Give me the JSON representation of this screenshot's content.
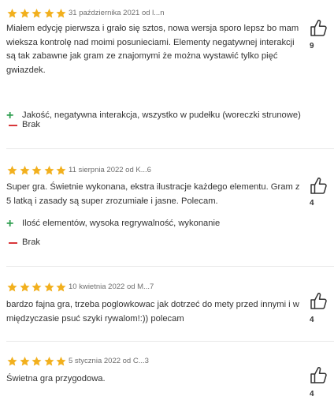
{
  "colors": {
    "star": "#f2b01e",
    "pro": "#2e9e4f",
    "con": "#d8373a",
    "divider": "#e8e8e8"
  },
  "icons": {
    "rating": "star-icon",
    "pros": "plus-icon",
    "cons": "minus-icon",
    "vote": "thumbs-up-icon"
  },
  "reviews": [
    {
      "rating": 5,
      "meta": "31 października 2021 od l...n",
      "text": "Miałem edycję pierwsza i grało się sztos, nowa wersja sporo lepsz bo mam wieksza kontrolę nad moimi posunieciami. Elementy negatywnej interakcji są tak zabawne jak gram ze znajomymi że można wystawić tylko pięć gwiazdek.",
      "pros": "Jakość, negatywna interakcja, wszystko w pudełku (woreczki strunowe)",
      "cons": "Brak",
      "votes": "9"
    },
    {
      "rating": 5,
      "meta": "11 sierpnia 2022 od K...6",
      "text": "Super gra. Świetnie wykonana, ekstra ilustracje każdego elementu. Gram z 5 latką i zasady są super zrozumiałe i jasne. Polecam.",
      "pros": "Ilość elementów, wysoka regrywalność, wykonanie",
      "cons": "Brak",
      "votes": "4"
    },
    {
      "rating": 5,
      "meta": "10 kwietnia 2022 od M...7",
      "text": "bardzo fajna gra, trzeba poglowkowac jak dotrzeć do mety przed innymi i w międzyczasie psuć szyki rywalom!:)) polecam",
      "votes": "4"
    },
    {
      "rating": 5,
      "meta": "5 stycznia 2022 od C...3",
      "text": "Świetna gra przygodowa.",
      "votes": "4"
    }
  ]
}
